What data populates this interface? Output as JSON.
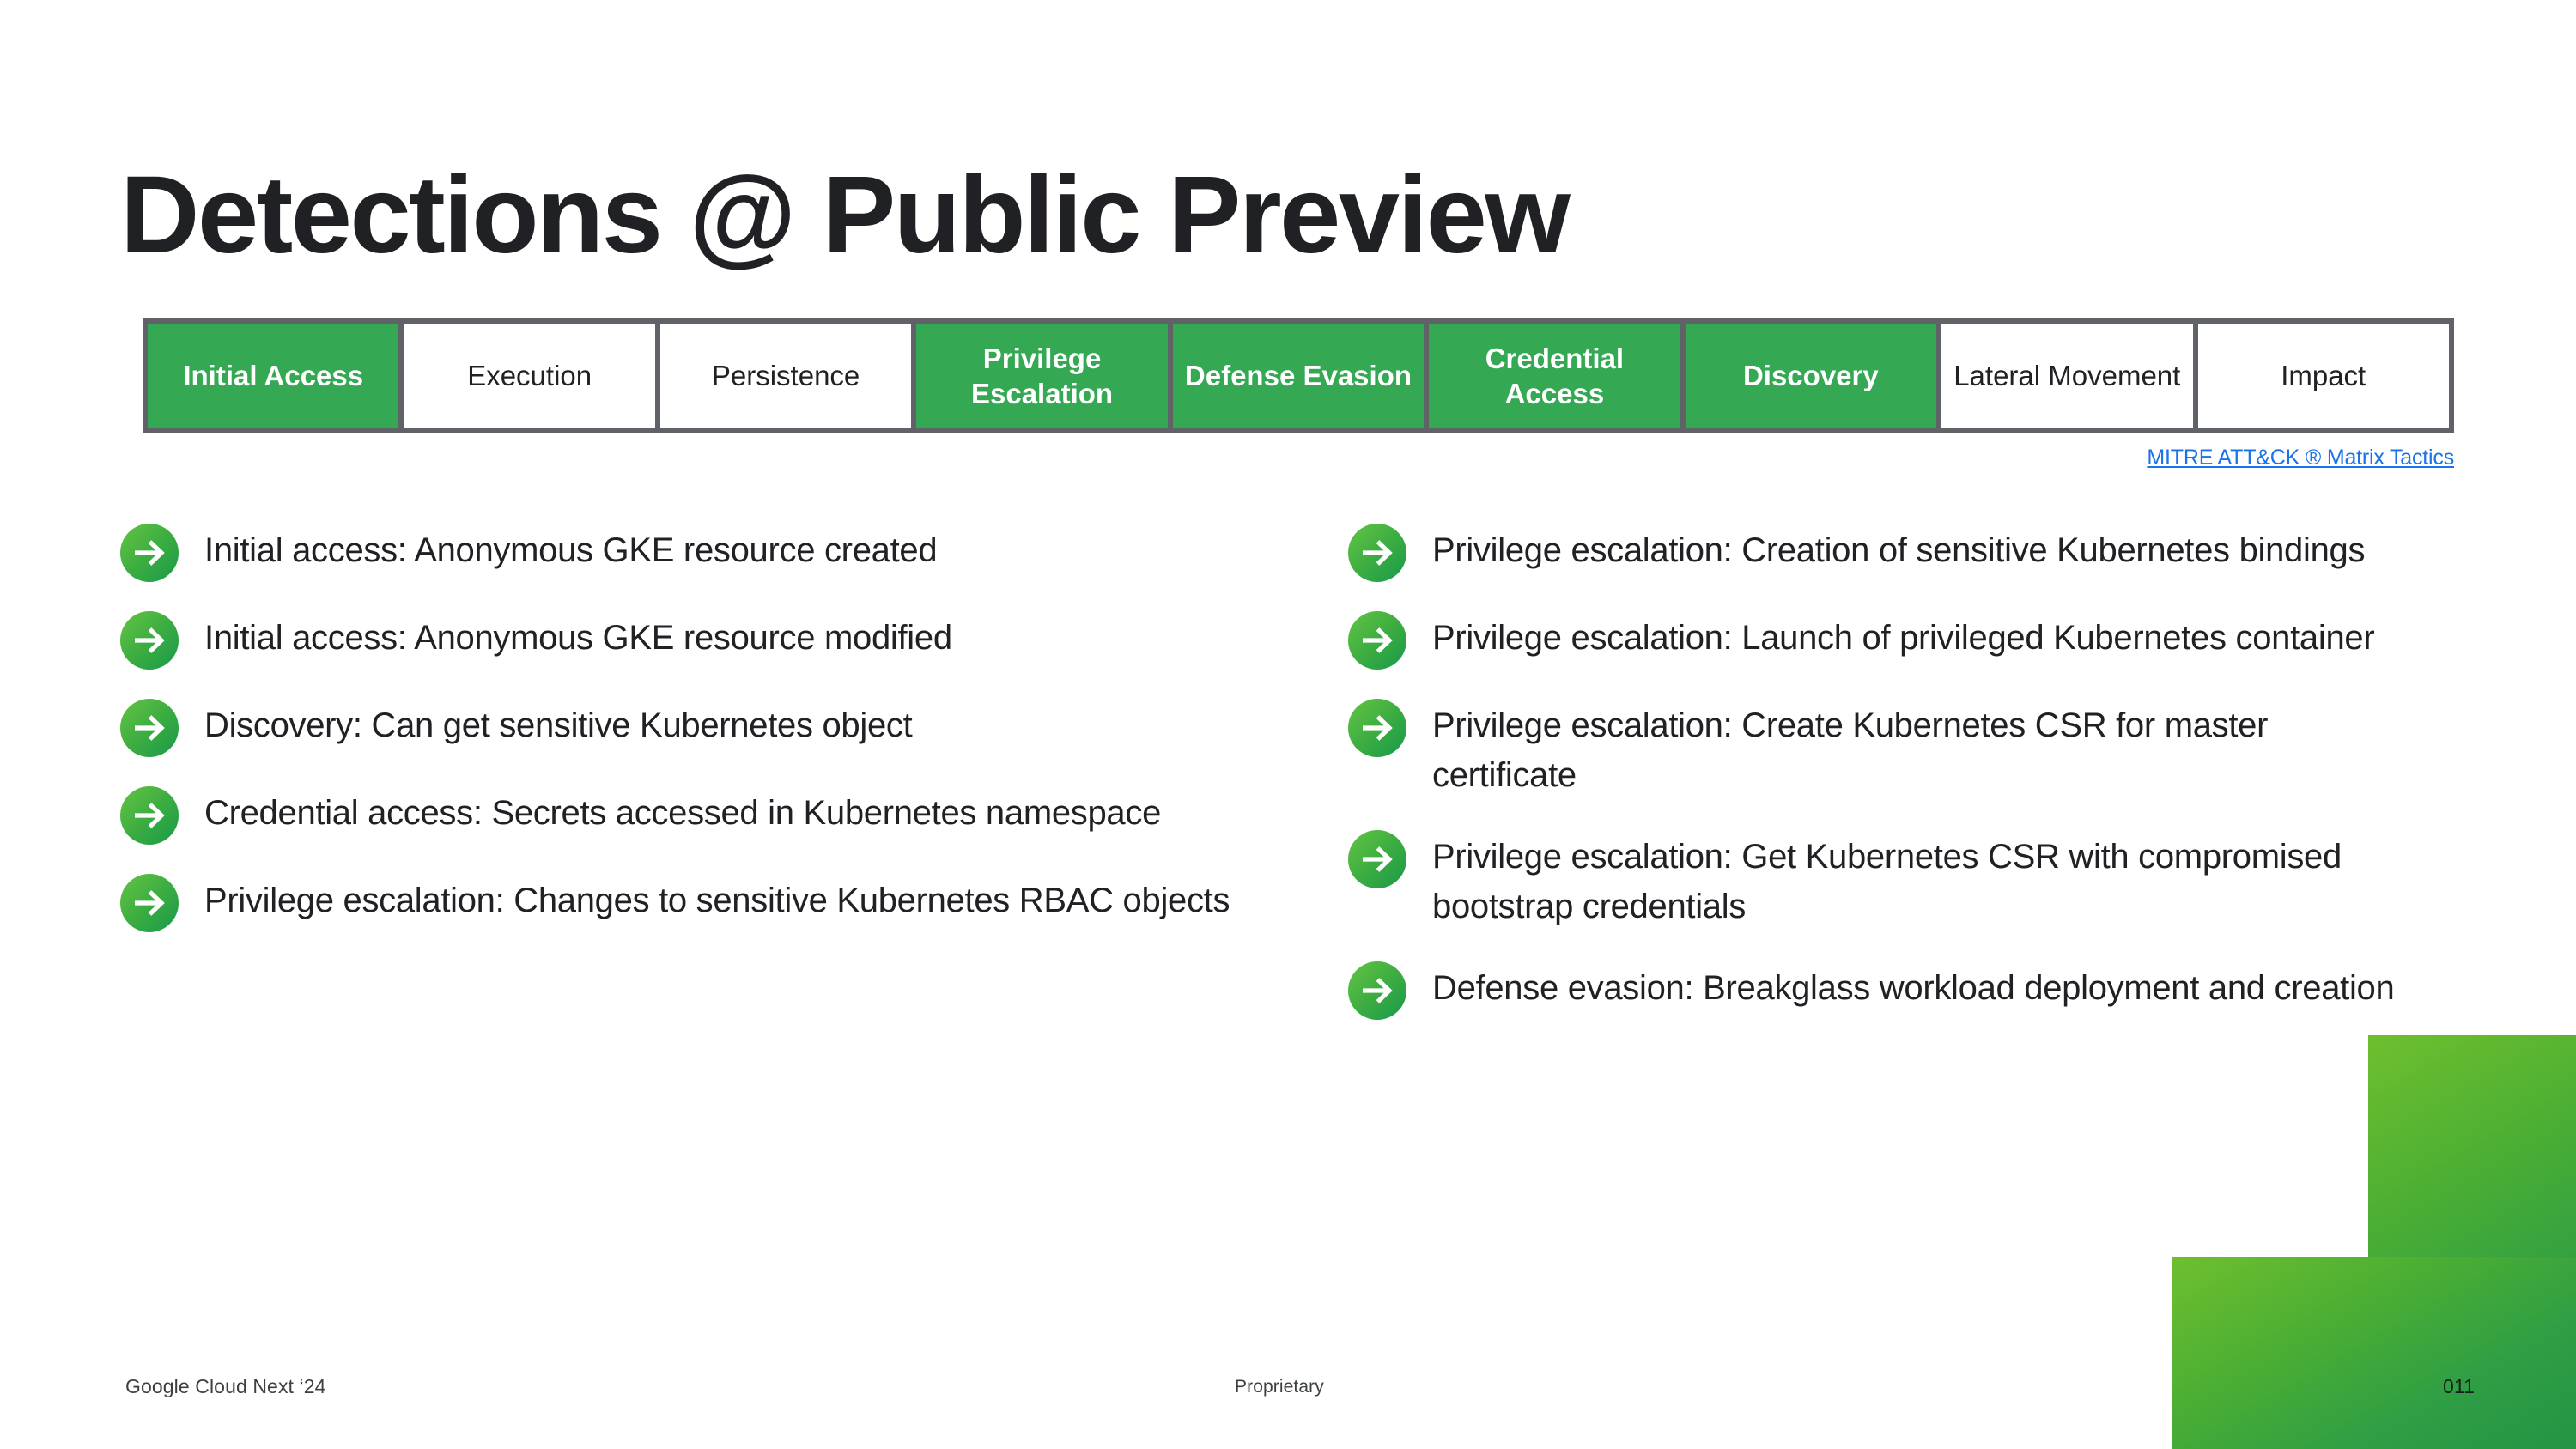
{
  "slide": {
    "title": "Detections @ Public Preview"
  },
  "tactics_matrix": {
    "link_label": "MITRE ATT&CK ® Matrix Tactics",
    "highlight_color": "#34A853",
    "border_color": "#5F6368",
    "cells": [
      {
        "label": "Initial Access",
        "highlighted": true
      },
      {
        "label": "Execution",
        "highlighted": false
      },
      {
        "label": "Persistence",
        "highlighted": false
      },
      {
        "label": "Privilege Escalation",
        "highlighted": true
      },
      {
        "label": "Defense Evasion",
        "highlighted": true
      },
      {
        "label": "Credential Access",
        "highlighted": true
      },
      {
        "label": "Discovery",
        "highlighted": true
      },
      {
        "label": "Lateral Movement",
        "highlighted": false
      },
      {
        "label": "Impact",
        "highlighted": false
      }
    ]
  },
  "detections": {
    "icon_name": "arrow-right-icon",
    "left_column": [
      {
        "text": "Initial access: Anonymous GKE resource created"
      },
      {
        "text": "Initial access: Anonymous GKE resource modified"
      },
      {
        "text": "Discovery: Can get sensitive Kubernetes object"
      },
      {
        "text": "Credential access: Secrets accessed in Kubernetes namespace"
      },
      {
        "text": "Privilege escalation: Changes to sensitive Kubernetes RBAC objects"
      }
    ],
    "right_column": [
      {
        "text": "Privilege escalation: Creation of sensitive Kubernetes bindings"
      },
      {
        "text": "Privilege escalation: Launch of privileged Kubernetes container"
      },
      {
        "text": "Privilege escalation: Create Kubernetes CSR for master certificate"
      },
      {
        "text": "Privilege escalation: Get Kubernetes CSR with compromised bootstrap credentials"
      },
      {
        "text": "Defense evasion: Breakglass workload deployment and creation"
      }
    ]
  },
  "footer": {
    "event": "Google Cloud Next ‘24",
    "notice": "Proprietary",
    "page_number": "011"
  },
  "decoration": {
    "gradient_from": "#6FBF2E",
    "gradient_to": "#249445"
  }
}
